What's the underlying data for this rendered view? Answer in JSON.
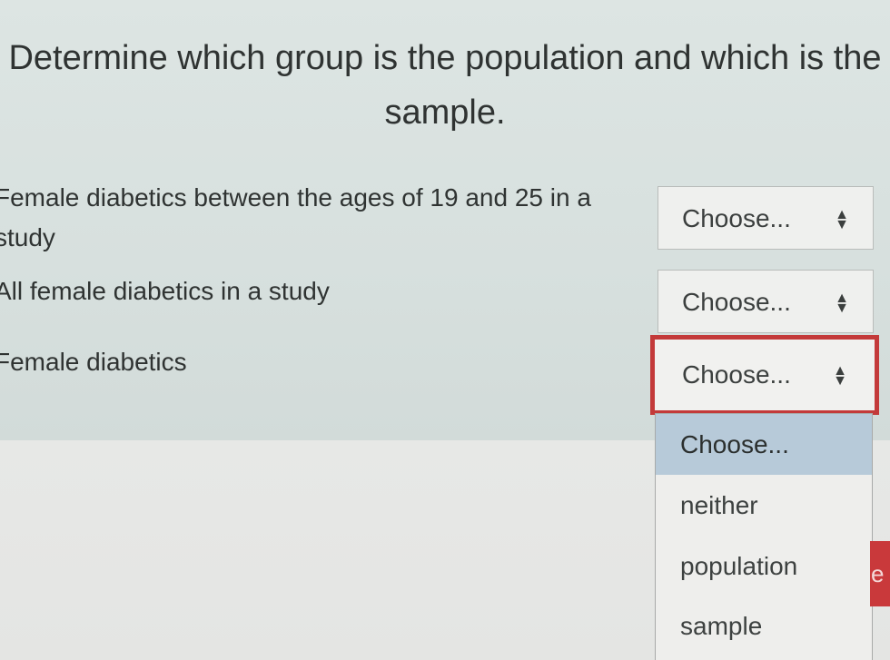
{
  "question": {
    "title": "Determine which group is the population and which is the sample."
  },
  "items": [
    {
      "label": "Female diabetics between the ages of 19 and 25 in a study",
      "selected": "Choose..."
    },
    {
      "label": "All female diabetics in a study",
      "selected": "Choose..."
    },
    {
      "label": "Female diabetics",
      "selected": "Choose..."
    }
  ],
  "dropdown": {
    "options": [
      "Choose...",
      "neither",
      "population",
      "sample"
    ],
    "highlighted": "Choose..."
  },
  "select_arrows_icon": "up-down-arrows-icon",
  "colors": {
    "focus_border": "#c33a3a",
    "option_highlight": "#b7cad9",
    "button": "#c9393b"
  },
  "partial_button": {
    "text": "e"
  }
}
